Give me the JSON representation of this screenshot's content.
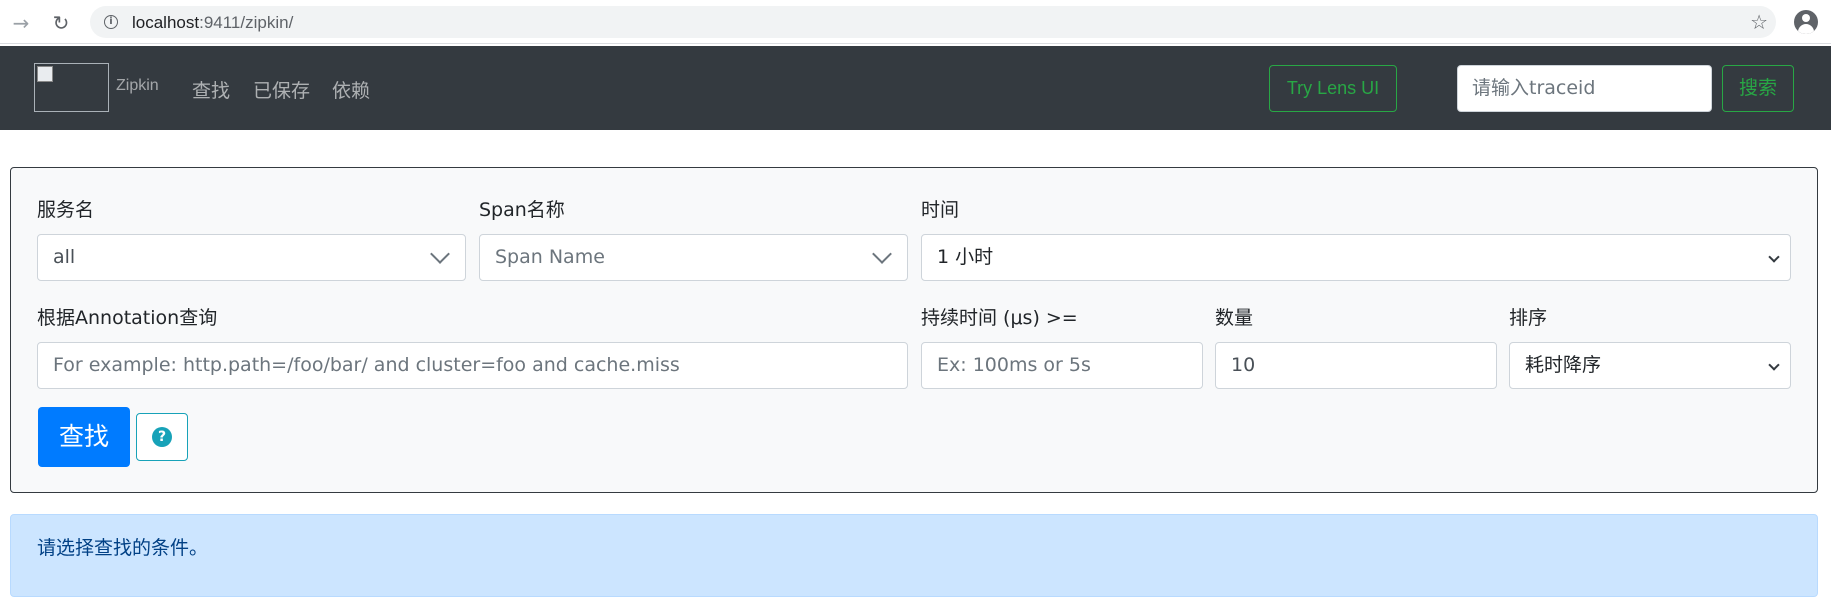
{
  "browser": {
    "url_host": "localhost",
    "url_rest": ":9411/zipkin/"
  },
  "navbar": {
    "brand": "Zipkin",
    "links": [
      "查找",
      "已保存",
      "依赖"
    ],
    "lens_button": "Try Lens UI",
    "traceid_placeholder": "请输入traceid",
    "search_button": "搜索"
  },
  "form": {
    "service_label": "服务名",
    "service_value": "all",
    "span_label": "Span名称",
    "span_placeholder": "Span Name",
    "time_label": "时间",
    "time_value": "1 小时",
    "annotation_label": "根据Annotation查询",
    "annotation_placeholder": "For example: http.path=/foo/bar/ and cluster=foo and cache.miss",
    "duration_label": "持续时间 (μs) >=",
    "duration_placeholder": "Ex: 100ms or 5s",
    "limit_label": "数量",
    "limit_value": "10",
    "sort_label": "排序",
    "sort_value": "耗时降序",
    "find_button": "查找",
    "help_icon": "question-circle-icon"
  },
  "alert": {
    "text": "请选择查找的条件。"
  },
  "colors": {
    "navbar_bg": "#343a40",
    "primary": "#007bff",
    "success": "#28a745",
    "info": "#17a2b8",
    "alert_bg": "#cce5ff"
  }
}
